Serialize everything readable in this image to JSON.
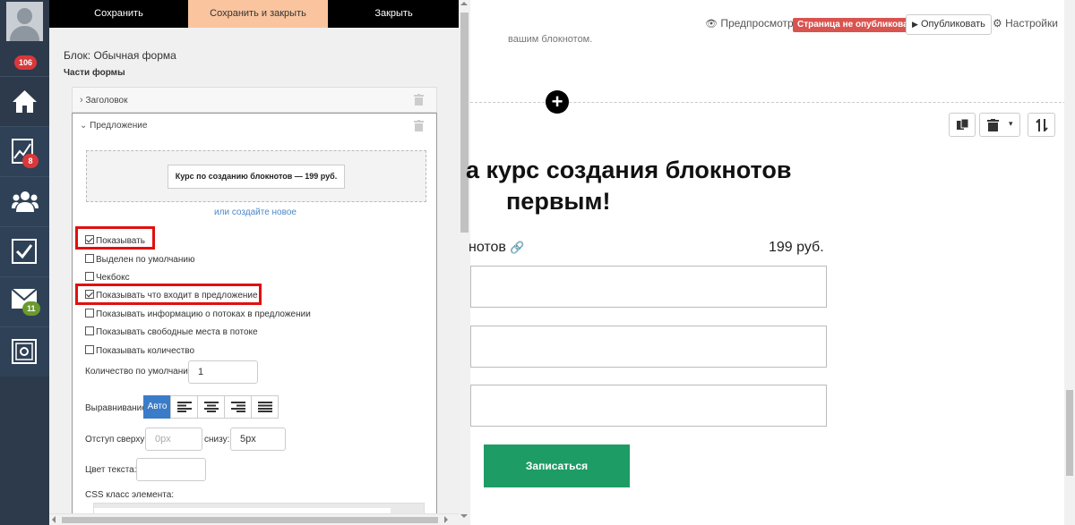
{
  "nav": {
    "notifications_badge": "106",
    "stats_badge": "8",
    "mail_badge": "11",
    "items": [
      {
        "name": "home-icon"
      },
      {
        "name": "stats-icon"
      },
      {
        "name": "users-icon"
      },
      {
        "name": "tasks-icon"
      },
      {
        "name": "mail-icon"
      },
      {
        "name": "settings-safe-icon"
      }
    ]
  },
  "toolbar": {
    "save_label": "Сохранить",
    "save_close_label": "Сохранить и закрыть",
    "close_label": "Закрыть"
  },
  "editor": {
    "title": "Блок: Обычная форма",
    "subtitle": "Части формы",
    "section_title_label": "Заголовок",
    "section_offer_label": "Предложение",
    "offer_button": "Курс по созданию блокнотов — 199 руб.",
    "create_new_link": "или создайте новое",
    "checkboxes": {
      "show": {
        "label": "Показывать",
        "checked": true
      },
      "default_selected": {
        "label": "Выделен по умолчанию",
        "checked": false
      },
      "checkbox": {
        "label": "Чекбокс",
        "checked": false
      },
      "show_contents": {
        "label": "Показывать что входит в предложение",
        "checked": true
      },
      "show_streams": {
        "label": "Показывать информацию о потоках в предложении",
        "checked": false
      },
      "show_free_places": {
        "label": "Показывать свободные места в потоке",
        "checked": false
      },
      "show_quantity": {
        "label": "Показывать количество",
        "checked": false
      }
    },
    "default_quantity_label": "Количество по умолчанию",
    "default_quantity_value": "1",
    "alignment_label": "Выравнивание",
    "alignment_auto": "Авто",
    "indent_top_label": "Отступ сверху:",
    "indent_top_placeholder": "0px",
    "indent_bottom_label": "снизу:",
    "indent_bottom_value": "5px",
    "text_color_label": "Цвет текста:",
    "css_class_label": "CSS класс элемента:"
  },
  "preview": {
    "fragment_text": "вашим блокнотом.",
    "preview_label": "Предпросмотр",
    "unpublished_badge": "Страница не опубликована",
    "publish_label": "Опубликовать",
    "settings_label": "Настройки",
    "heading_line1": "а курс создания блокнотов",
    "heading_line2": "первым!",
    "offer_name": "нотов",
    "offer_price": "199 руб.",
    "submit_label": "Записаться"
  },
  "colors": {
    "highlight": "#e01010",
    "accent_button": "#1e9c66",
    "unpublished": "#d9534f",
    "nav_bg": "#2d3a4b",
    "save_close_bg": "#f9c49e"
  }
}
